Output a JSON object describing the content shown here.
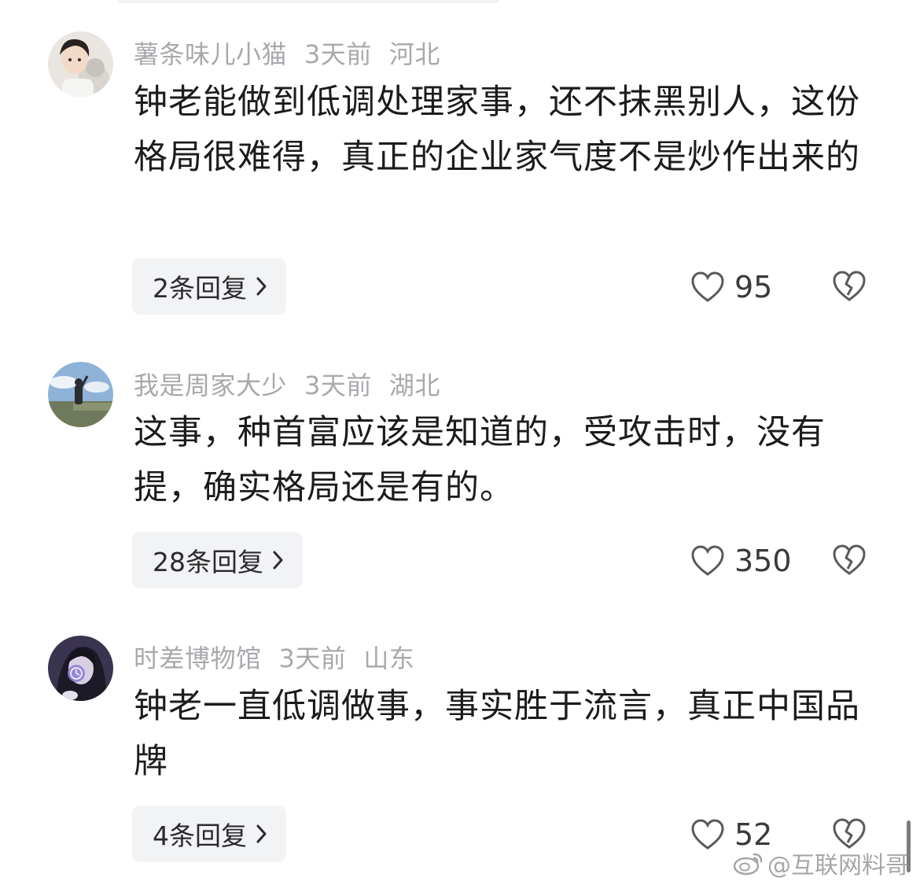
{
  "comments": [
    {
      "username": "薯条味儿小猫",
      "time": "3天前",
      "location": "河北",
      "text": "钟老能做到低调处理家事，还不抹黑别人，这份格局很难得，真正的企业家气度不是炒作出来的",
      "replies_label": "2条回复",
      "likes": "95"
    },
    {
      "username": "我是周家大少",
      "time": "3天前",
      "location": "湖北",
      "text": "这事，种首富应该是知道的，受攻击时，没有提，确实格局还是有的。",
      "replies_label": "28条回复",
      "likes": "350"
    },
    {
      "username": "时差博物馆",
      "time": "3天前",
      "location": "山东",
      "text": "钟老一直低调做事，事实胜于流言，真正中国品牌",
      "replies_label": "4条回复",
      "likes": "52"
    }
  ],
  "watermark": "@互联网料哥",
  "icons": {
    "like": "heart-outline-icon",
    "dislike": "broken-heart-icon",
    "reply_chevron": "chevron-right-icon"
  },
  "colors": {
    "meta": "#a8a9ad",
    "text": "#1c1c1e",
    "reply_bg": "#f2f3f5"
  }
}
